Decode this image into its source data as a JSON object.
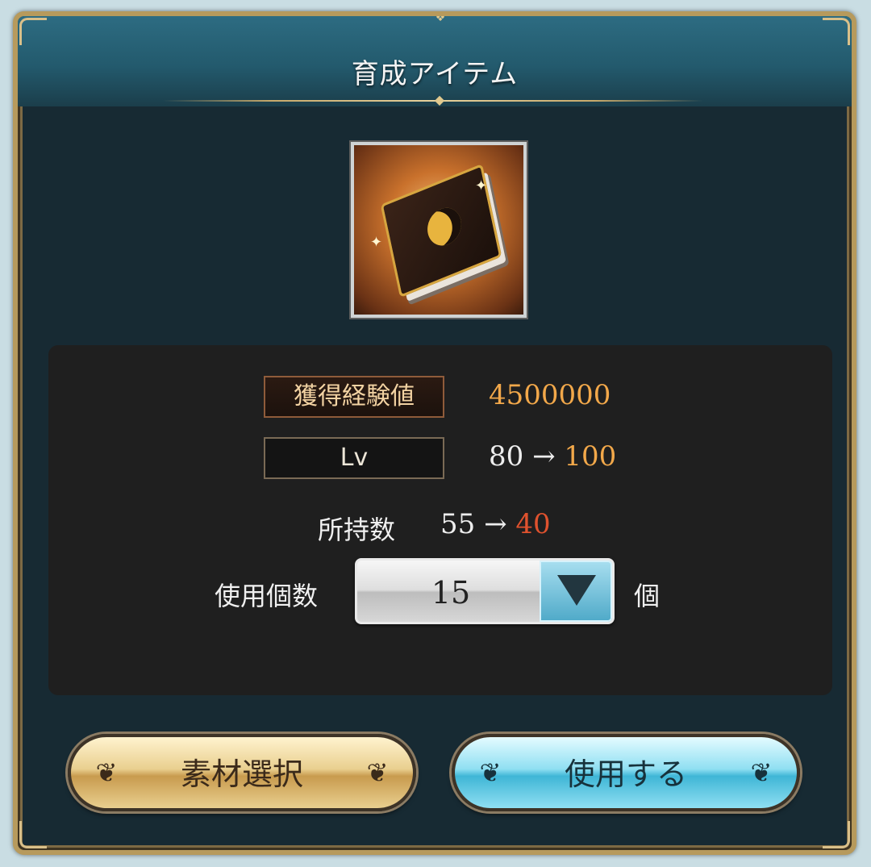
{
  "dialog": {
    "title": "育成アイテム"
  },
  "item": {
    "icon": "moon-tome-icon"
  },
  "stats": {
    "exp_label": "獲得経験値",
    "exp_value": "4500000",
    "lv_label": "Lv",
    "lv_from": "80",
    "lv_arrow": "→",
    "lv_to": "100",
    "owned_label": "所持数",
    "owned_from": "55",
    "owned_arrow": "→",
    "owned_to": "40",
    "use_label": "使用個数",
    "use_value": "15",
    "unit": "個"
  },
  "buttons": {
    "material_select": "素材選択",
    "use": "使用する"
  },
  "colors": {
    "accent_orange": "#f2a84a",
    "accent_red": "#e0522e",
    "use_button": "#3fb6d6",
    "material_button": "#c89b4e"
  }
}
